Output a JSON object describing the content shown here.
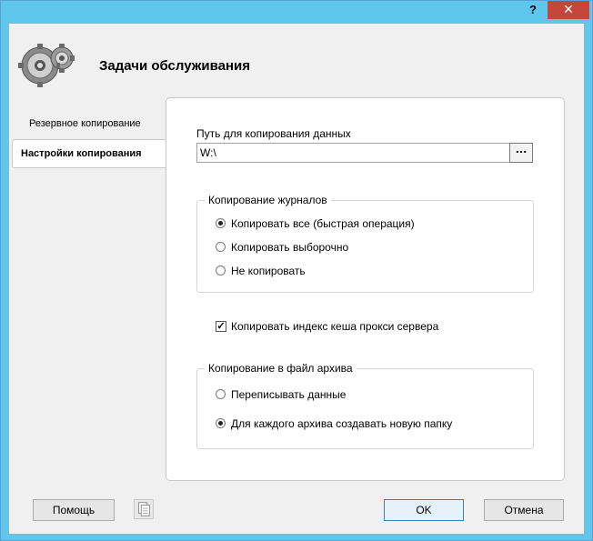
{
  "window": {
    "help_glyph": "?",
    "close_glyph": "✕"
  },
  "header": {
    "title": "Задачи обслуживания",
    "icon": "gears-icon"
  },
  "nav": {
    "items": [
      {
        "label": "Резервное копирование",
        "selected": false
      },
      {
        "label": "Настройки копирования",
        "selected": true
      }
    ]
  },
  "path": {
    "label": "Путь для копирования данных",
    "value": "W:\\",
    "browse_label": "..."
  },
  "log_copy": {
    "title": "Копирование журналов",
    "options": [
      {
        "label": "Копировать все (быстрая операция)",
        "selected": true
      },
      {
        "label": "Копировать выборочно",
        "selected": false
      },
      {
        "label": "Не копировать",
        "selected": false
      }
    ]
  },
  "cache_index": {
    "label": "Копировать индекс кеша прокси сервера",
    "checked": true
  },
  "archive": {
    "title": "Копирование в файл архива",
    "options": [
      {
        "label": "Переписывать данные",
        "selected": false
      },
      {
        "label": "Для каждого архива создавать новую папку",
        "selected": true
      }
    ]
  },
  "footer": {
    "help_label": "Помощь",
    "ok_label": "OK",
    "cancel_label": "Отмена"
  },
  "colors": {
    "titlebar": "#5fc6ec",
    "close": "#c7463c",
    "client_bg": "#f0f0f0"
  }
}
